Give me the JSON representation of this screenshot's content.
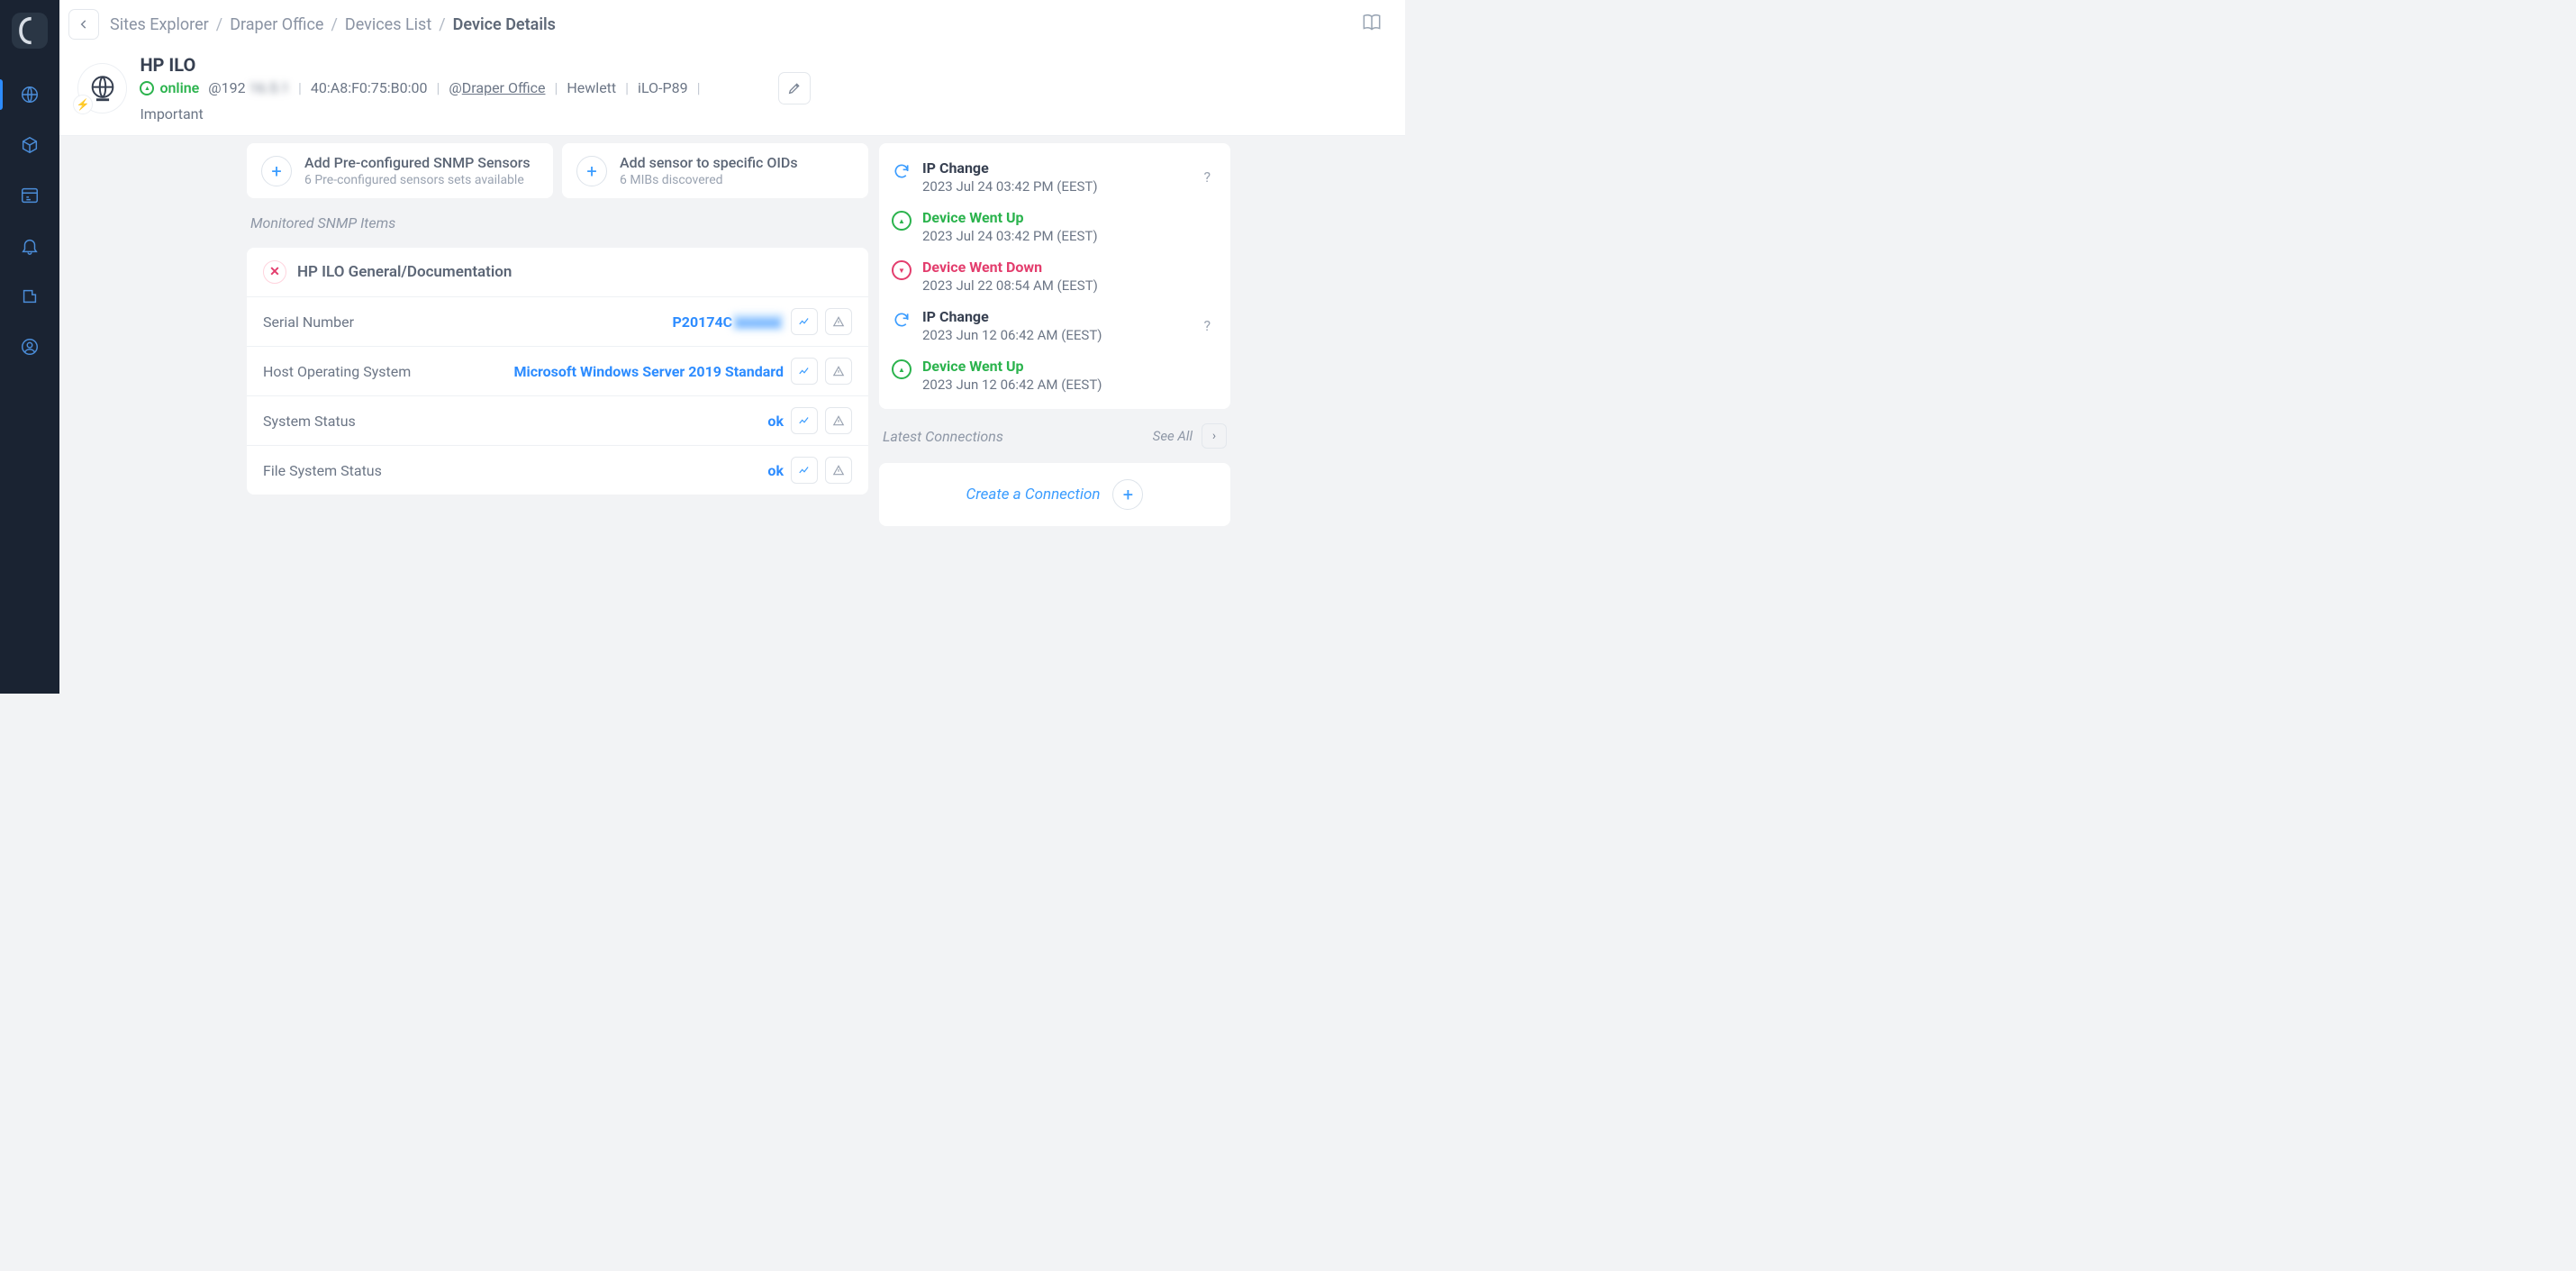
{
  "breadcrumbs": [
    "Sites Explorer",
    "Draper Office",
    "Devices List",
    "Device Details"
  ],
  "device": {
    "title": "HP ILO",
    "status": "online",
    "ip_prefix": "@192",
    "ip_blur": "16.5.1",
    "mac": "40:A8:F0:75:B0:00",
    "location_prefix": "@",
    "location": "Draper Office",
    "vendor": "Hewlett",
    "model": "iLO-P89",
    "importance": "Important"
  },
  "add_cards": [
    {
      "title": "Add Pre-configured SNMP Sensors",
      "sub": "6 Pre-configured sensors sets available"
    },
    {
      "title": "Add sensor to specific OIDs",
      "sub": "6 MIBs discovered"
    }
  ],
  "snmp": {
    "section_heading": "Monitored SNMP Items",
    "panel_title": "HP ILO General/Documentation",
    "rows": [
      {
        "label": "Serial Number",
        "value": "P20174C",
        "blurred": "xxxxxx"
      },
      {
        "label": "Host Operating System",
        "value": "Microsoft Windows Server 2019 Standard"
      },
      {
        "label": "System Status",
        "value": "ok"
      },
      {
        "label": "File System Status",
        "value": "ok"
      }
    ]
  },
  "events": [
    {
      "type": "sync",
      "title": "IP Change",
      "time": "2023 Jul 24 03:42 PM (EEST)",
      "help": true
    },
    {
      "type": "up",
      "title": "Device Went Up",
      "time": "2023 Jul 24 03:42 PM (EEST)"
    },
    {
      "type": "down",
      "title": "Device Went Down",
      "time": "2023 Jul 22 08:54 AM (EEST)"
    },
    {
      "type": "sync",
      "title": "IP Change",
      "time": "2023 Jun 12 06:42 AM (EEST)",
      "help": true
    },
    {
      "type": "up",
      "title": "Device Went Up",
      "time": "2023 Jun 12 06:42 AM (EEST)"
    }
  ],
  "connections": {
    "heading": "Latest Connections",
    "see_all": "See All",
    "create": "Create a Connection"
  }
}
